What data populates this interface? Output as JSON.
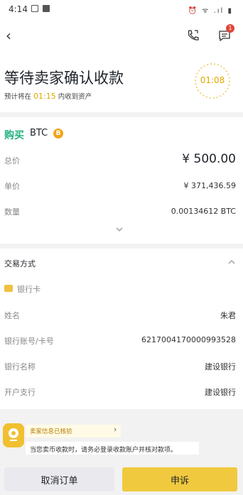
{
  "status_bar": {
    "time": "4:14",
    "right_icons": "⏰ ᯤ .ıl ▮"
  },
  "nav": {
    "back_icon": "‹",
    "chat_badge": "1"
  },
  "header": {
    "title": "等待卖家确认收款",
    "subtitle_prefix": "预计将在",
    "subtitle_time": "01:15",
    "subtitle_suffix": "内收到资产",
    "timer": "01:08"
  },
  "order": {
    "side": "购买",
    "coin": "BTC",
    "coin_icon": "B",
    "rows": [
      {
        "label": "总价",
        "value": "¥ 500.00"
      },
      {
        "label": "单价",
        "value": "¥ 371,436.59"
      },
      {
        "label": "数量",
        "value": "0.00134612 BTC"
      }
    ]
  },
  "payment": {
    "title": "交易方式",
    "method": "银行卡",
    "rows": [
      {
        "label": "姓名",
        "value": "朱君"
      },
      {
        "label": "银行账号/卡号",
        "value": "6217004170000993528"
      },
      {
        "label": "银行名称",
        "value": "建设银行"
      },
      {
        "label": "开户支行",
        "value": "建设银行"
      }
    ]
  },
  "banner": {
    "pill": "卖家信息已核验",
    "pill_arrow": "›",
    "notice": "当您卖币收款时，请务必登录收款账户并核对款项。"
  },
  "buttons": {
    "cancel": "取消订单",
    "appeal": "申诉"
  },
  "colors": {
    "accent_yellow": "#f0c93e",
    "buy_green": "#22b07d",
    "timer_orange": "#e0a800"
  }
}
